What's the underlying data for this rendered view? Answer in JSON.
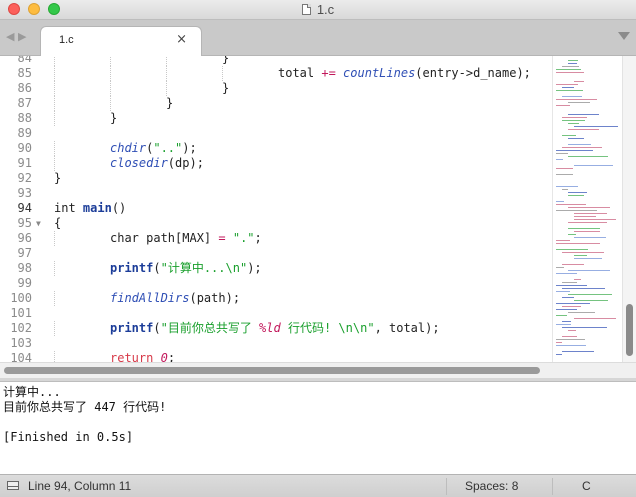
{
  "window": {
    "title": "1.c"
  },
  "tabs": [
    {
      "label": "1.c",
      "close": "×"
    }
  ],
  "editor": {
    "current_line": "94",
    "lines": [
      {
        "num": "84",
        "fold": "",
        "indent": 3,
        "tokens": [
          {
            "t": "}",
            "c": ""
          }
        ]
      },
      {
        "num": "85",
        "fold": "",
        "indent": 4,
        "tokens": [
          {
            "t": "total ",
            "c": ""
          },
          {
            "t": "+=",
            "c": "op"
          },
          {
            "t": " ",
            "c": ""
          },
          {
            "t": "countLines",
            "c": "fn"
          },
          {
            "t": "(entry->d_name);",
            "c": ""
          }
        ]
      },
      {
        "num": "86",
        "fold": "",
        "indent": 3,
        "tokens": [
          {
            "t": "}",
            "c": ""
          }
        ]
      },
      {
        "num": "87",
        "fold": "",
        "indent": 2,
        "tokens": [
          {
            "t": "}",
            "c": ""
          }
        ]
      },
      {
        "num": "88",
        "fold": "",
        "indent": 1,
        "tokens": [
          {
            "t": "}",
            "c": ""
          }
        ]
      },
      {
        "num": "89",
        "fold": "",
        "indent": 0,
        "tokens": []
      },
      {
        "num": "90",
        "fold": "",
        "indent": 1,
        "tokens": [
          {
            "t": "chdir",
            "c": "fn"
          },
          {
            "t": "(",
            "c": ""
          },
          {
            "t": "\"..\"",
            "c": "str"
          },
          {
            "t": ");",
            "c": ""
          }
        ]
      },
      {
        "num": "91",
        "fold": "",
        "indent": 1,
        "tokens": [
          {
            "t": "closedir",
            "c": "fn"
          },
          {
            "t": "(dp);",
            "c": ""
          }
        ]
      },
      {
        "num": "92",
        "fold": "",
        "indent": 0,
        "tokens": [
          {
            "t": "}",
            "c": ""
          }
        ]
      },
      {
        "num": "93",
        "fold": "",
        "indent": 0,
        "tokens": []
      },
      {
        "num": "94",
        "fold": "",
        "indent": 0,
        "tokens": [
          {
            "t": "int ",
            "c": ""
          },
          {
            "t": "main",
            "c": "fnb"
          },
          {
            "t": "()",
            "c": ""
          }
        ]
      },
      {
        "num": "95",
        "fold": "▼",
        "indent": 0,
        "tokens": [
          {
            "t": "{",
            "c": ""
          }
        ]
      },
      {
        "num": "96",
        "fold": "",
        "indent": 1,
        "tokens": [
          {
            "t": "char path[MAX] ",
            "c": ""
          },
          {
            "t": "=",
            "c": "op"
          },
          {
            "t": " ",
            "c": ""
          },
          {
            "t": "\".\"",
            "c": "str"
          },
          {
            "t": ";",
            "c": ""
          }
        ]
      },
      {
        "num": "97",
        "fold": "",
        "indent": 0,
        "tokens": []
      },
      {
        "num": "98",
        "fold": "",
        "indent": 1,
        "tokens": [
          {
            "t": "printf",
            "c": "fnb"
          },
          {
            "t": "(",
            "c": ""
          },
          {
            "t": "\"计算中...",
            "c": "str"
          },
          {
            "t": "\\n",
            "c": "str"
          },
          {
            "t": "\"",
            "c": "str"
          },
          {
            "t": ");",
            "c": ""
          }
        ]
      },
      {
        "num": "99",
        "fold": "",
        "indent": 0,
        "tokens": []
      },
      {
        "num": "100",
        "fold": "",
        "indent": 1,
        "tokens": [
          {
            "t": "findAllDirs",
            "c": "fn"
          },
          {
            "t": "(path);",
            "c": ""
          }
        ]
      },
      {
        "num": "101",
        "fold": "",
        "indent": 0,
        "tokens": []
      },
      {
        "num": "102",
        "fold": "",
        "indent": 1,
        "tokens": [
          {
            "t": "printf",
            "c": "fnb"
          },
          {
            "t": "(",
            "c": ""
          },
          {
            "t": "\"目前你总共写了 ",
            "c": "str"
          },
          {
            "t": "%ld",
            "c": "fmt"
          },
          {
            "t": " 行代码! ",
            "c": "str"
          },
          {
            "t": "\\n\\n",
            "c": "str"
          },
          {
            "t": "\"",
            "c": "str"
          },
          {
            "t": ", total);",
            "c": ""
          }
        ]
      },
      {
        "num": "103",
        "fold": "",
        "indent": 0,
        "tokens": []
      },
      {
        "num": "104",
        "fold": "",
        "indent": 1,
        "tokens": [
          {
            "t": "return",
            "c": "kw"
          },
          {
            "t": " ",
            "c": ""
          },
          {
            "t": "0",
            "c": "num"
          },
          {
            "t": ";",
            "c": ""
          }
        ]
      }
    ]
  },
  "output": {
    "lines": [
      "计算中...",
      "目前你总共写了 447 行代码!",
      "",
      "[Finished in 0.5s]"
    ]
  },
  "status": {
    "position": "Line 94, Column 11",
    "spaces": "Spaces: 8",
    "syntax": "C"
  },
  "colors": {
    "keyword": "#d73a49",
    "function": "#2f4fb5",
    "string": "#199f2c",
    "operator": "#c2185b"
  }
}
